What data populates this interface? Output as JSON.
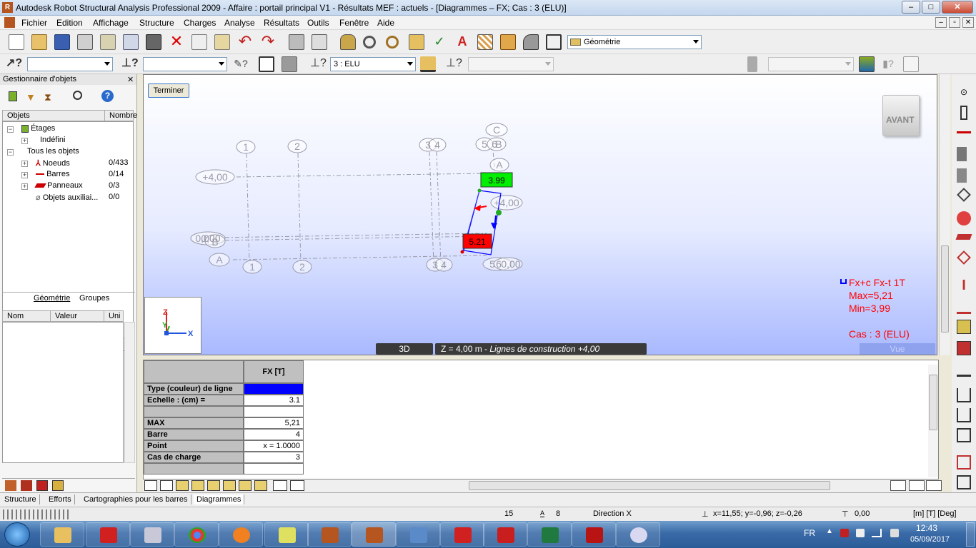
{
  "app": {
    "title": "Autodesk Robot Structural Analysis Professional 2009 - Affaire : portail principal V1 - Résultats MEF : actuels - [Diagrammes – FX; Cas : 3 (ELU)]",
    "icon_letter": "R",
    "window_buttons": [
      "–",
      "□",
      "✕"
    ],
    "mdi_buttons": [
      "–",
      "▫",
      "✕"
    ]
  },
  "menu": [
    "Fichier",
    "Edition",
    "Affichage",
    "Structure",
    "Charges",
    "Analyse",
    "Résultats",
    "Outils",
    "Fenêtre",
    "Aide"
  ],
  "toolbar": {
    "layout_combo": "Géométrie",
    "case_combo": "3 : ELU"
  },
  "object_manager": {
    "title": "Gestionnaire d'objets",
    "col_objects": "Objets",
    "col_number": "Nombre",
    "tree": [
      {
        "label": "Étages",
        "count": ""
      },
      {
        "label": "Indéfini",
        "count": ""
      },
      {
        "label": "Tous les objets",
        "count": ""
      },
      {
        "label": "Noeuds",
        "count": "0/433"
      },
      {
        "label": "Barres",
        "count": "0/14"
      },
      {
        "label": "Panneaux",
        "count": "0/3"
      },
      {
        "label": "Objets auxiliai...",
        "count": "0/0"
      }
    ],
    "tabs": [
      "Géométrie",
      "Groupes"
    ],
    "props_cols": [
      "Nom",
      "Valeur",
      "Uni"
    ]
  },
  "viewport": {
    "terminate_button": "Terminer",
    "view_cube": "AVANT",
    "axis_labels": {
      "z": "Z",
      "y": "Y",
      "x": "X"
    },
    "grid_labels": {
      "top_numbers": [
        "1",
        "2",
        "3",
        "4",
        "5",
        "6"
      ],
      "top_letters": [
        "C",
        "B",
        "A"
      ],
      "bottom_numbers": [
        "1",
        "2",
        "3",
        "4",
        "5",
        "6"
      ],
      "bottom_letter": "A",
      "levels": [
        "+4,00",
        "+4,00",
        "0,00",
        "0,00",
        "0,00"
      ],
      "letter_b": "B"
    },
    "diagram_labels": {
      "top": "3.99",
      "bottom": "5.21"
    },
    "legend": {
      "line1": "Fx+c Fx-t  1T",
      "line2": "Max=5,21",
      "line3": "Min=3,99",
      "line4": "Cas : 3 (ELU)"
    },
    "bottom_bar": {
      "mode": "3D",
      "z_prefix": "Z = 4,00 m - ",
      "z_suffix": "Lignes de construction +4,00",
      "view": "Vue"
    },
    "colors": {
      "max_box": "#ff0000",
      "min_box": "#00ee00",
      "legend_text": "#ff0000"
    }
  },
  "table": {
    "header": "FX [T]",
    "rows": [
      {
        "label": "Type (couleur) de ligne",
        "value": ""
      },
      {
        "label": "Echelle : (cm) =",
        "value": "3.1"
      },
      {
        "label": "",
        "value": ""
      },
      {
        "label": "MAX",
        "value": "5,21"
      },
      {
        "label": "Barre",
        "value": "4"
      },
      {
        "label": "Point",
        "value": "x = 1.0000"
      },
      {
        "label": "Cas de charge",
        "value": "3"
      },
      {
        "label": "",
        "value": ""
      }
    ],
    "line_color": "#0000ff"
  },
  "bottom_tabs": [
    "Structure",
    "Efforts",
    "Cartographies pour les barres",
    "Diagrammes"
  ],
  "status": {
    "num1": "15",
    "num2": "8",
    "direction": "Direction X",
    "coords": "x=11,55; y=-0,96; z=-0,26",
    "value": "0,00",
    "units": "[m] [T] [Deg]"
  },
  "taskbar": {
    "lang": "FR",
    "time": "12:43",
    "date": "05/09/2017"
  }
}
